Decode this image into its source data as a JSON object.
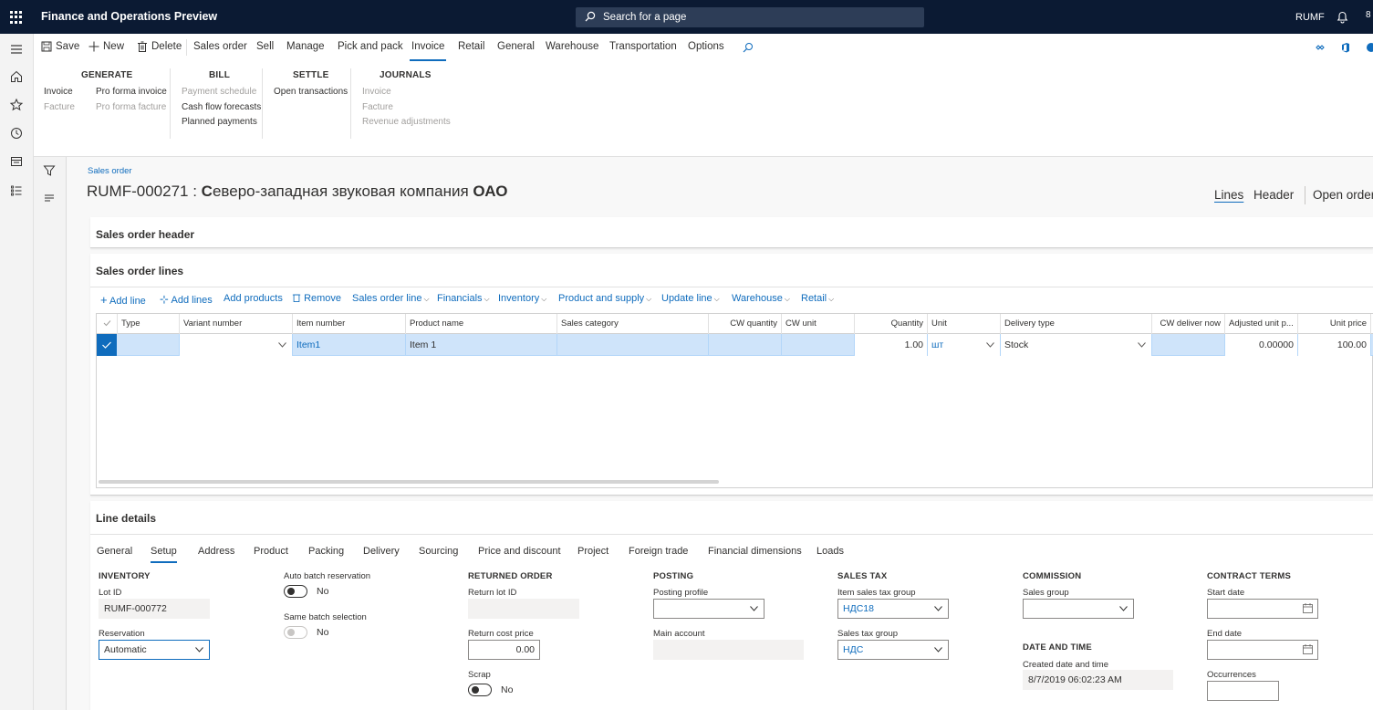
{
  "topbar": {
    "title": "Finance and Operations Preview",
    "search_placeholder": "Search for a page",
    "company": "RUMF",
    "more": "8"
  },
  "action_pane": {
    "save": "Save",
    "new": "New",
    "delete": "Delete",
    "tabs": [
      "Sales order",
      "Sell",
      "Manage",
      "Pick and pack",
      "Invoice",
      "Retail",
      "General",
      "Warehouse",
      "Transportation",
      "Options"
    ],
    "active_tab": "Invoice",
    "groups": {
      "generate": {
        "title": "GENERATE",
        "items": [
          "Invoice",
          "Facture",
          "Pro forma invoice",
          "Pro forma facture"
        ]
      },
      "bill": {
        "title": "BILL",
        "items": [
          "Payment schedule",
          "Cash flow forecasts",
          "Planned payments"
        ]
      },
      "settle": {
        "title": "SETTLE",
        "items": [
          "Open transactions"
        ]
      },
      "journals": {
        "title": "JOURNALS",
        "items": [
          "Invoice",
          "Facture",
          "Revenue adjustments"
        ]
      }
    }
  },
  "page": {
    "breadcrumb": "Sales order",
    "title_id": "RUMF-000271 : ",
    "title_name_c": "С",
    "title_name_rest": "еверо-западная звуковая компания ",
    "title_name_oao": "ОАО",
    "view_lines": "Lines",
    "view_header": "Header",
    "view_open_order": "Open order"
  },
  "fasttabs": {
    "header": "Sales order header",
    "lines": "Sales order lines",
    "details": "Line details"
  },
  "lines_toolbar": {
    "add_line": "Add line",
    "add_lines": "Add lines",
    "add_products": "Add products",
    "remove": "Remove",
    "menus": [
      "Sales order line",
      "Financials",
      "Inventory",
      "Product and supply",
      "Update line",
      "Warehouse",
      "Retail"
    ]
  },
  "grid": {
    "columns": [
      "Type",
      "Variant number",
      "Item number",
      "Product name",
      "Sales category",
      "CW quantity",
      "CW unit",
      "Quantity",
      "Unit",
      "Delivery type",
      "CW deliver now",
      "Adjusted unit p...",
      "Unit price"
    ],
    "row": {
      "type": "",
      "variant": "",
      "item_number": "Item1",
      "product_name": "Item 1",
      "sales_category": "",
      "cw_quantity": "",
      "cw_unit": "",
      "quantity": "1.00",
      "unit": "шт",
      "delivery_type": "Stock",
      "cw_deliver_now": "",
      "adjusted_unit_price": "0.00000",
      "unit_price": "100.00"
    }
  },
  "line_details": {
    "tabs": [
      "General",
      "Setup",
      "Address",
      "Product",
      "Packing",
      "Delivery",
      "Sourcing",
      "Price and discount",
      "Project",
      "Foreign trade",
      "Financial dimensions",
      "Loads"
    ],
    "active_tab": "Setup",
    "inventory": {
      "heading": "INVENTORY",
      "lot_id_label": "Lot ID",
      "lot_id": "RUMF-000772",
      "reservation_label": "Reservation",
      "reservation": "Automatic"
    },
    "batch": {
      "auto_label": "Auto batch reservation",
      "auto_value": "No",
      "same_label": "Same batch selection",
      "same_value": "No"
    },
    "returned": {
      "heading": "RETURNED ORDER",
      "return_lot_label": "Return lot ID",
      "return_lot": "",
      "cost_label": "Return cost price",
      "cost": "0.00",
      "scrap_label": "Scrap",
      "scrap_value": "No"
    },
    "posting": {
      "heading": "POSTING",
      "profile_label": "Posting profile",
      "profile": "",
      "main_account_label": "Main account",
      "main_account": ""
    },
    "sales_tax": {
      "heading": "SALES TAX",
      "item_group_label": "Item sales tax group",
      "item_group": "НДС18",
      "group_label": "Sales tax group",
      "group": "НДС"
    },
    "commission": {
      "heading": "COMMISSION",
      "sales_group_label": "Sales group",
      "sales_group": ""
    },
    "date_time": {
      "heading": "DATE AND TIME",
      "created_label": "Created date and time",
      "created": "8/7/2019 06:02:23 AM"
    },
    "contract": {
      "heading": "CONTRACT TERMS",
      "start_label": "Start date",
      "start": "",
      "end_label": "End date",
      "end": "",
      "occ_label": "Occurrences",
      "occ": ""
    }
  }
}
